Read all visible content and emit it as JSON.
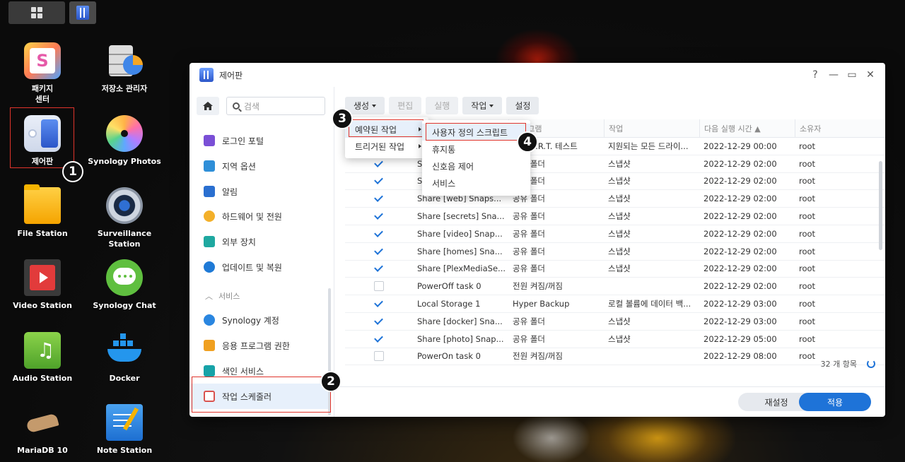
{
  "desktop": {
    "icons": [
      {
        "label": "패키지\n센터",
        "icon": "package-center-icon"
      },
      {
        "label": "저장소 관리자",
        "icon": "storage-manager-icon"
      },
      {
        "label": "제어판",
        "icon": "control-panel-icon"
      },
      {
        "label": "Synology Photos",
        "icon": "synology-photos-icon"
      },
      {
        "label": "File Station",
        "icon": "file-station-icon"
      },
      {
        "label": "Surveillance Station",
        "icon": "surveillance-station-icon"
      },
      {
        "label": "Video Station",
        "icon": "video-station-icon"
      },
      {
        "label": "Synology Chat",
        "icon": "synology-chat-icon"
      },
      {
        "label": "Audio Station",
        "icon": "audio-station-icon"
      },
      {
        "label": "Docker",
        "icon": "docker-icon"
      },
      {
        "label": "MariaDB 10",
        "icon": "mariadb-icon"
      },
      {
        "label": "Note Station",
        "icon": "note-station-icon"
      }
    ]
  },
  "steps": [
    "1",
    "2",
    "3",
    "4"
  ],
  "window": {
    "title": "제어판",
    "controls": {
      "help": "?",
      "minimize": "—",
      "maximize": "▭",
      "close": "✕"
    }
  },
  "sidebar": {
    "search_placeholder": "검색",
    "items": [
      {
        "label": "로그인 포털",
        "icon": "login-portal-icon",
        "color": "#7a4fd6"
      },
      {
        "label": "지역 옵션",
        "icon": "regional-options-icon",
        "color": "#2f8fd8"
      },
      {
        "label": "알림",
        "icon": "notification-icon",
        "color": "#2a6fd0"
      },
      {
        "label": "하드웨어 및 전원",
        "icon": "hardware-power-icon",
        "color": "#f3b02a"
      },
      {
        "label": "외부 장치",
        "icon": "external-devices-icon",
        "color": "#1fa8a0"
      },
      {
        "label": "업데이트 및 복원",
        "icon": "update-restore-icon",
        "color": "#1f7ad6"
      }
    ],
    "section_label": "서비스",
    "service_items": [
      {
        "label": "Synology 계정",
        "icon": "synology-account-icon",
        "color": "#2a86e0"
      },
      {
        "label": "응용 프로그램 권한",
        "icon": "app-privileges-icon",
        "color": "#f0a020"
      },
      {
        "label": "색인 서비스",
        "icon": "indexing-service-icon",
        "color": "#17a3a8"
      },
      {
        "label": "작업 스케줄러",
        "icon": "task-scheduler-icon",
        "color": "#d9534f"
      }
    ]
  },
  "toolbar": {
    "create": "생성",
    "edit": "편집",
    "run": "실행",
    "action": "작업",
    "settings": "설정"
  },
  "grid": {
    "headers": {
      "program": "프로그램",
      "action": "작업",
      "next_run": "다음 실행 시간 ▲",
      "owner": "소유자"
    },
    "rows": [
      {
        "checked": true,
        "name": "S.M.A.R.T. 테스트",
        "program": "S.M.A.R.T. 테스트",
        "action": "지원되는 모든 드라이...",
        "next": "2022-12-29 00:00",
        "owner": "root"
      },
      {
        "checked": true,
        "name": "Share [music] Sna...",
        "program": "공유 폴더",
        "action": "스냅샷",
        "next": "2022-12-29 02:00",
        "owner": "root"
      },
      {
        "checked": true,
        "name": "Share [docs] Snap...",
        "program": "공유 폴더",
        "action": "스냅샷",
        "next": "2022-12-29 02:00",
        "owner": "root"
      },
      {
        "checked": true,
        "name": "Share [web] Snaps...",
        "program": "공유 폴더",
        "action": "스냅샷",
        "next": "2022-12-29 02:00",
        "owner": "root"
      },
      {
        "checked": true,
        "name": "Share [secrets] Sna...",
        "program": "공유 폴더",
        "action": "스냅샷",
        "next": "2022-12-29 02:00",
        "owner": "root"
      },
      {
        "checked": true,
        "name": "Share [video] Snap...",
        "program": "공유 폴더",
        "action": "스냅샷",
        "next": "2022-12-29 02:00",
        "owner": "root"
      },
      {
        "checked": true,
        "name": "Share [homes] Sna...",
        "program": "공유 폴더",
        "action": "스냅샷",
        "next": "2022-12-29 02:00",
        "owner": "root"
      },
      {
        "checked": true,
        "name": "Share [PlexMediaSe...",
        "program": "공유 폴더",
        "action": "스냅샷",
        "next": "2022-12-29 02:00",
        "owner": "root"
      },
      {
        "checked": false,
        "name": "PowerOff task 0",
        "program": "전원 켜짐/꺼짐",
        "action": "",
        "next": "2022-12-29 02:00",
        "owner": "root"
      },
      {
        "checked": true,
        "name": "Local Storage 1",
        "program": "Hyper Backup",
        "action": "로컬 볼륨에 데이터 백...",
        "next": "2022-12-29 03:00",
        "owner": "root"
      },
      {
        "checked": true,
        "name": "Share [docker] Sna...",
        "program": "공유 폴더",
        "action": "스냅샷",
        "next": "2022-12-29 03:00",
        "owner": "root"
      },
      {
        "checked": true,
        "name": "Share [photo] Snap...",
        "program": "공유 폴더",
        "action": "스냅샷",
        "next": "2022-12-29 05:00",
        "owner": "root"
      },
      {
        "checked": false,
        "name": "PowerOn task 0",
        "program": "전원 켜짐/꺼짐",
        "action": "",
        "next": "2022-12-29 08:00",
        "owner": "root"
      }
    ],
    "count": "32 개 항목"
  },
  "menus": {
    "create_menu": [
      {
        "label": "예약된 작업"
      },
      {
        "label": "트리거된 작업"
      }
    ],
    "scheduled_submenu": [
      {
        "label": "사용자 정의 스크립트"
      },
      {
        "label": "휴지통"
      },
      {
        "label": "신호음 제어"
      },
      {
        "label": "서비스"
      }
    ]
  },
  "footer": {
    "reset": "재설정",
    "apply": "적용"
  },
  "colors": {
    "accent": "#1e73d8",
    "highlight": "#e0342b"
  }
}
